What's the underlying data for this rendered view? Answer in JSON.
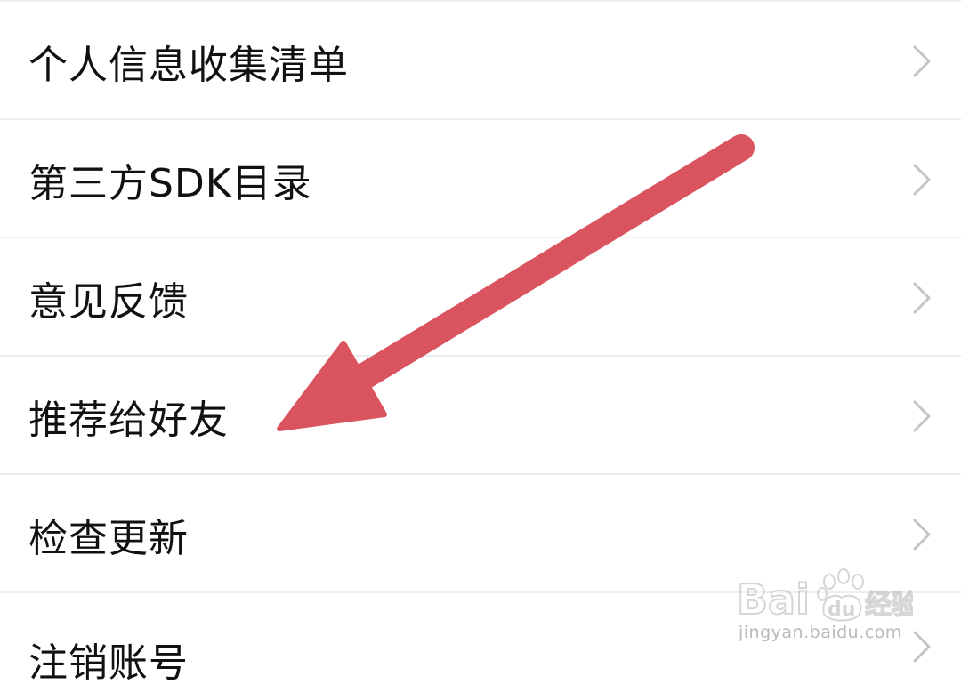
{
  "menu": {
    "items": [
      {
        "label": "个人信息收集清单",
        "icon": "chevron-right-icon"
      },
      {
        "label": "第三方SDK目录",
        "icon": "chevron-right-icon"
      },
      {
        "label": "意见反馈",
        "icon": "chevron-right-icon"
      },
      {
        "label": "推荐给好友",
        "icon": "chevron-right-icon"
      },
      {
        "label": "检查更新",
        "icon": "chevron-right-icon"
      },
      {
        "label": "注销账号",
        "icon": "chevron-right-icon"
      }
    ]
  },
  "annotation": {
    "arrow_color": "#d9545f",
    "target": "推荐给好友"
  },
  "watermark": {
    "brand": "Baidu经验",
    "url": "jingyan.baidu.com"
  },
  "colors": {
    "background": "#ffffff",
    "text": "#111111",
    "divider": "#ededed",
    "chevron": "#c4c4c4"
  }
}
